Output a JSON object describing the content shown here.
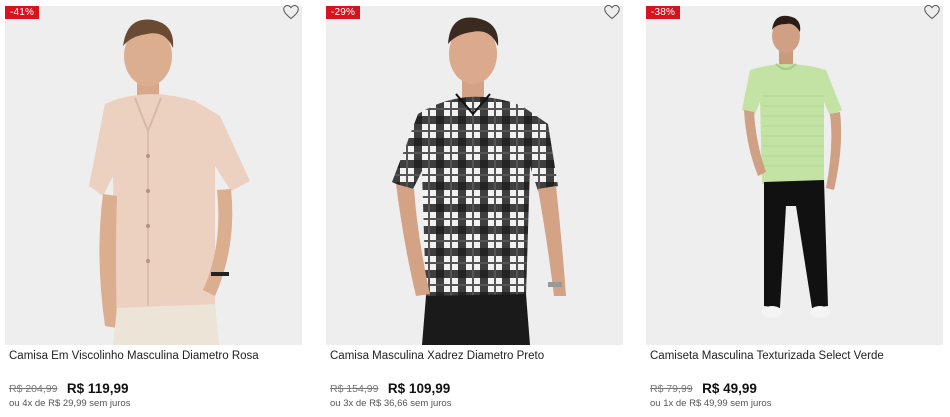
{
  "products": [
    {
      "discount": "-41%",
      "name": "Camisa Em Viscolinho Masculina Diametro Rosa",
      "old_price": "R$ 204,99",
      "price": "R$ 119,99",
      "installments": "ou 4x de R$ 29,99 sem juros",
      "image_icon": "shirt-pink-photo"
    },
    {
      "discount": "-29%",
      "name": "Camisa Masculina Xadrez Diametro Preto",
      "old_price": "R$ 154,99",
      "price": "R$ 109,99",
      "installments": "ou 3x de R$ 36,66 sem juros",
      "image_icon": "shirt-plaid-photo"
    },
    {
      "discount": "-38%",
      "name": "Camiseta Masculina Texturizada Select Verde",
      "old_price": "R$ 79,99",
      "price": "R$ 49,99",
      "installments": "ou 1x de R$ 49,99 sem juros",
      "image_icon": "tshirt-green-photo"
    }
  ],
  "colors": {
    "badge": "#d9131e",
    "image_bg": "#efefef"
  },
  "favorite_icon": "heart-outline-icon"
}
